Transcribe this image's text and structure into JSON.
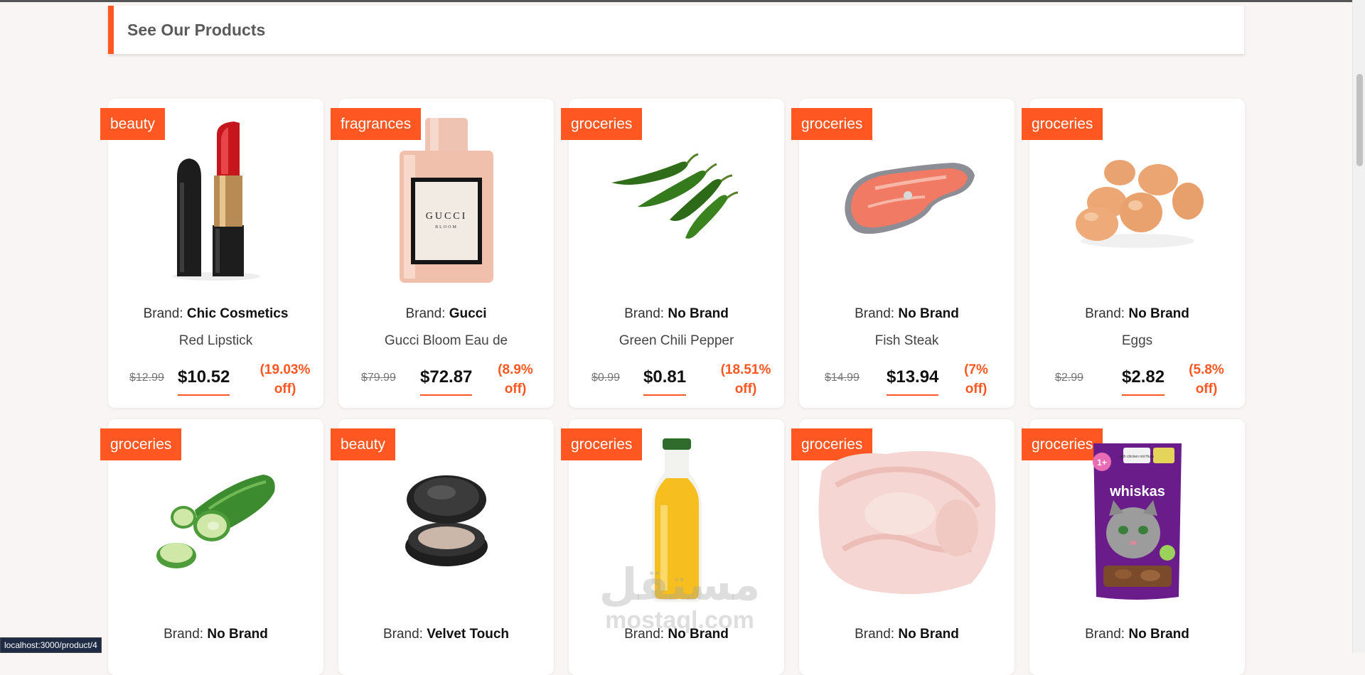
{
  "section": {
    "title": "See Our Products"
  },
  "labels": {
    "brand_prefix": "Brand:"
  },
  "accent_color": "#ff5722",
  "products": [
    {
      "category": "beauty",
      "brand": "Chic Cosmetics",
      "title": "Red Lipstick",
      "old_price": "$12.99",
      "price": "$10.52",
      "discount_line1": "(19.03%",
      "discount_line2": "off)",
      "image": "lipstick"
    },
    {
      "category": "fragrances",
      "brand": "Gucci",
      "title": "Gucci Bloom Eau de",
      "old_price": "$79.99",
      "price": "$72.87",
      "discount_line1": "(8.9%",
      "discount_line2": "off)",
      "image": "perfume-bottle"
    },
    {
      "category": "groceries",
      "brand": "No Brand",
      "title": "Green Chili Pepper",
      "old_price": "$0.99",
      "price": "$0.81",
      "discount_line1": "(18.51%",
      "discount_line2": "off)",
      "image": "chili-peppers"
    },
    {
      "category": "groceries",
      "brand": "No Brand",
      "title": "Fish Steak",
      "old_price": "$14.99",
      "price": "$13.94",
      "discount_line1": "(7%",
      "discount_line2": "off)",
      "image": "fish-steak"
    },
    {
      "category": "groceries",
      "brand": "No Brand",
      "title": "Eggs",
      "old_price": "$2.99",
      "price": "$2.82",
      "discount_line1": "(5.8%",
      "discount_line2": "off)",
      "image": "eggs"
    },
    {
      "category": "groceries",
      "brand": "No Brand",
      "image": "cucumber"
    },
    {
      "category": "beauty",
      "brand": "Velvet Touch",
      "image": "powder-compact"
    },
    {
      "category": "groceries",
      "brand": "No Brand",
      "image": "juice-bottle"
    },
    {
      "category": "groceries",
      "brand": "No Brand",
      "image": "raw-chicken"
    },
    {
      "category": "groceries",
      "brand": "No Brand",
      "image": "cat-food-pouch"
    }
  ],
  "status_bar": {
    "url": "localhost:3000/product/4"
  },
  "watermark": {
    "arabic": "مستقل",
    "latin": "mostaql.com"
  },
  "perfume_label": {
    "brand": "GUCCI",
    "sub": "BLOOM"
  },
  "pouch_label": {
    "brand": "whiskas",
    "age": "1+",
    "flavor": "with chicken mit Huhn"
  }
}
